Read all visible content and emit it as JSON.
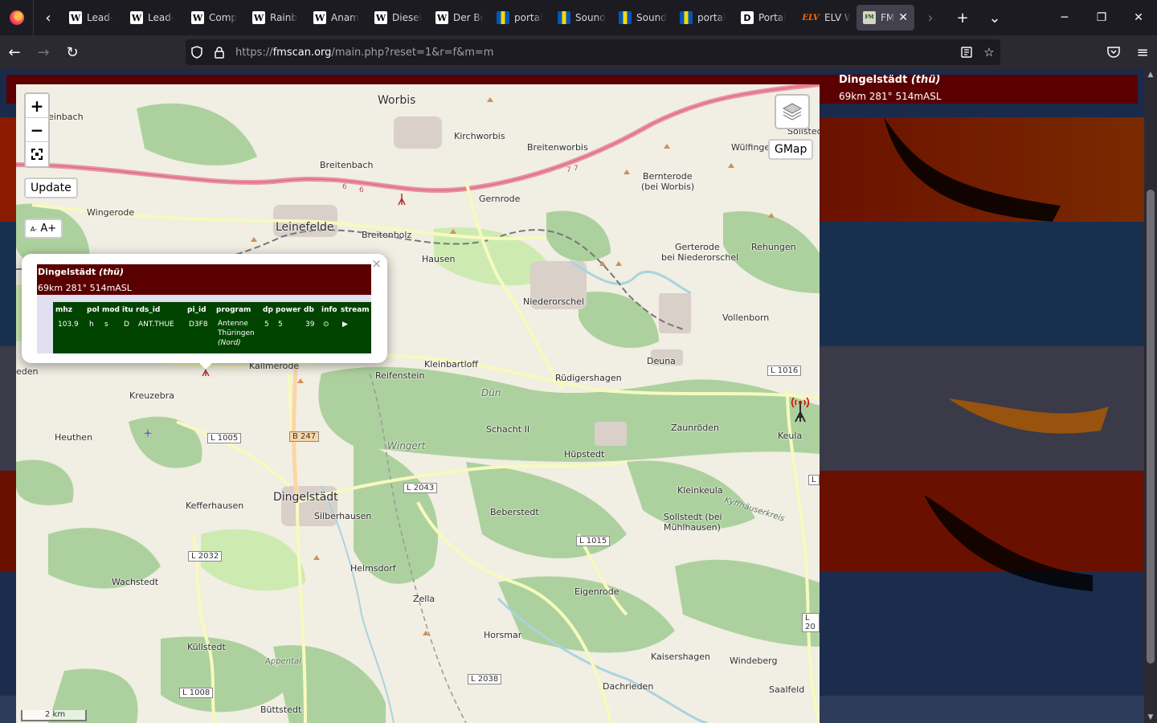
{
  "browser": {
    "tabs": [
      {
        "favicon": "W",
        "kind": "w",
        "label": "Lead-"
      },
      {
        "favicon": "W",
        "kind": "w",
        "label": "Lead-"
      },
      {
        "favicon": "W",
        "kind": "w",
        "label": "Comp"
      },
      {
        "favicon": "W",
        "kind": "w",
        "label": "Rainb"
      },
      {
        "favicon": "W",
        "kind": "w",
        "label": "Anam"
      },
      {
        "favicon": "W",
        "kind": "w",
        "label": "Diesel"
      },
      {
        "favicon": "W",
        "kind": "w",
        "label": "Der Bo"
      },
      {
        "favicon": "",
        "kind": "ua",
        "label": "portal"
      },
      {
        "favicon": "",
        "kind": "ua",
        "label": "Sound"
      },
      {
        "favicon": "",
        "kind": "ua",
        "label": "Sound"
      },
      {
        "favicon": "",
        "kind": "ua",
        "label": "portal"
      },
      {
        "favicon": "D",
        "kind": "d",
        "label": "Portal"
      },
      {
        "favicon": "ELV",
        "kind": "elv",
        "label": "ELV W"
      },
      {
        "favicon": "FM",
        "kind": "fm",
        "label": "FM",
        "active": true
      }
    ],
    "url_scheme": "https://",
    "url_host": "fmscan.org",
    "url_path": "/main.php?reset=1&r=f&m=m"
  },
  "station": {
    "name": "Dingelstädt",
    "region": "(thü)",
    "info": "69km 281° 514mASL"
  },
  "map": {
    "zoom_in": "+",
    "zoom_out": "−",
    "update_label": "Update",
    "font_small": "A-",
    "font_large": "A+",
    "gmap_label": "GMap",
    "scale": "2 km",
    "places": [
      {
        "name": "Worbis",
        "big": true
      },
      {
        "name": "einbach"
      },
      {
        "name": "Kirchworbis"
      },
      {
        "name": "Breitenworbis"
      },
      {
        "name": "Sollstedt"
      },
      {
        "name": "Wülfingerode"
      },
      {
        "name": "Breitenbach"
      },
      {
        "name": "Gernrode"
      },
      {
        "name": "Bernterode"
      },
      {
        "name": "(bei Worbis)"
      },
      {
        "name": "Wingerode"
      },
      {
        "name": "Leinefelde",
        "big": true
      },
      {
        "name": "Breitenholz"
      },
      {
        "name": "Hausen"
      },
      {
        "name": "Gerterode"
      },
      {
        "name": "bei Niederorschel"
      },
      {
        "name": "Rehungen"
      },
      {
        "name": "Niederorschel"
      },
      {
        "name": "Vollenborn"
      },
      {
        "name": "Kallmerode"
      },
      {
        "name": "Reifenstein"
      },
      {
        "name": "Kleinbartloff"
      },
      {
        "name": "Rüdigershagen"
      },
      {
        "name": "Deuna"
      },
      {
        "name": "eden"
      },
      {
        "name": "Kreuzebra"
      },
      {
        "name": "Dün",
        "area": true
      },
      {
        "name": "Schacht II"
      },
      {
        "name": "Zaunröden"
      },
      {
        "name": "Keula"
      },
      {
        "name": "Heuthen"
      },
      {
        "name": "Wingert",
        "area": true
      },
      {
        "name": "Hüpstedt"
      },
      {
        "name": "Kleinkeula"
      },
      {
        "name": "Kefferhausen"
      },
      {
        "name": "Dingelstädt",
        "big": true
      },
      {
        "name": "Silberhausen"
      },
      {
        "name": "Beberstedt"
      },
      {
        "name": "Sollstedt (bei"
      },
      {
        "name": "Mühlhausen)"
      },
      {
        "name": "Kyffhäuserkreis",
        "area": true
      },
      {
        "name": "Wachstedt"
      },
      {
        "name": "Helmsdorf"
      },
      {
        "name": "Zella"
      },
      {
        "name": "Eigenrode"
      },
      {
        "name": "Horsmar"
      },
      {
        "name": "Küllstedt"
      },
      {
        "name": "Kaisershagen"
      },
      {
        "name": "Windeberg"
      },
      {
        "name": "Appental",
        "area": true
      },
      {
        "name": "Dachrieden"
      },
      {
        "name": "Saalfeld"
      },
      {
        "name": "Büttstedt"
      }
    ],
    "roads": [
      "L 1016",
      "L 1005",
      "B 247",
      "L 2043",
      "L 1015",
      "L 2032",
      "L 2038",
      "L 1008",
      "L",
      "L 20",
      "6",
      "6",
      "7",
      "7"
    ]
  },
  "popup": {
    "title_name": "Dingelstädt",
    "title_region": "(thü)",
    "sub": "69km 281° 514mASL",
    "close": "×",
    "headers": [
      "mhz",
      "pol",
      "mod",
      "itu",
      "rds_id",
      "pi_id",
      "program",
      "dp",
      "power",
      "db",
      "info",
      "stream"
    ],
    "row": {
      "mhz": "103.9",
      "pol": "h",
      "mod": "s",
      "itu": "D",
      "rds_id": "ANT.THUE",
      "pi_id": "D3F8",
      "program_1": "Antenne",
      "program_2": "Thüringen",
      "program_3": "(Nord)",
      "dp": "5",
      "power": "5",
      "db": "39",
      "info": "⊙",
      "stream": "▶"
    }
  },
  "colors": {
    "station_bar": "#5a0000",
    "table_bg": "#004400"
  }
}
